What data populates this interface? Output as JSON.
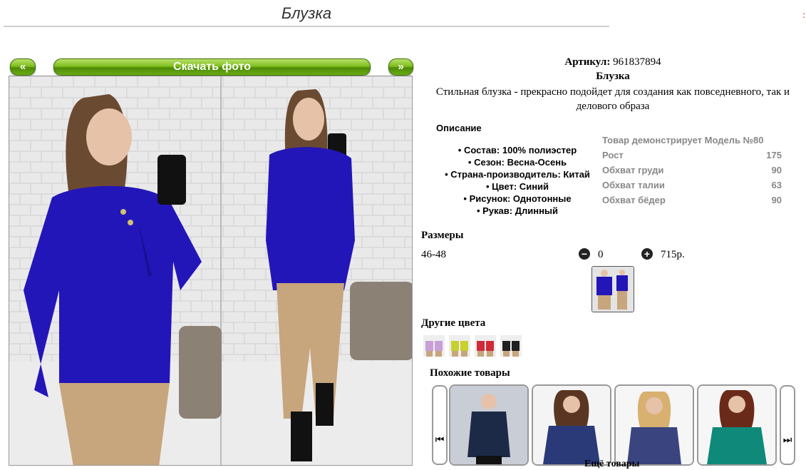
{
  "header": {
    "title": "Блузка",
    "corner_mark": ":"
  },
  "gallery": {
    "prev_label": "«",
    "download_label": "Скачать фото",
    "next_label": "»"
  },
  "product": {
    "article_label": "Артикул:",
    "article_value": "961837894",
    "name": "Блузка",
    "description": "Стильная блузка - прекрасно подойдет для создания как повседневного, так и делового образа",
    "description_heading": "Описание",
    "specs": [
      "Состав: 100% полиэстер",
      "Сезон: Весна-Осень",
      "Страна-производитель: Китай",
      "Цвет: Синий",
      "Рисунок: Однотонные",
      "Рукав: Длинный"
    ],
    "model": {
      "heading": "Товар демонстрирует Модель №80",
      "rows": [
        {
          "label": "Рост",
          "value": "175"
        },
        {
          "label": "Обхват груди",
          "value": "90"
        },
        {
          "label": "Обхват талии",
          "value": "63"
        },
        {
          "label": "Обхват бёдер",
          "value": "90"
        }
      ]
    },
    "sizes_heading": "Размеры",
    "size": "46-48",
    "quantity": "0",
    "price": "715р.",
    "minus_icon": "minus-circle-icon",
    "plus_icon": "plus-circle-icon"
  },
  "other_colors": {
    "heading": "Другие цвета",
    "swatches": [
      "#c8a0d8",
      "#c8d030",
      "#d02a3a",
      "#202020"
    ]
  },
  "similar": {
    "heading": "Похожие товары",
    "prev_icon": "skip-back-icon",
    "next_icon": "skip-forward-icon",
    "items_colors": [
      "#1c2a48",
      "#2a3a78",
      "#3a4580",
      "#0f8a7a"
    ],
    "more_label": "Ещё товары"
  },
  "colors": {
    "accent_green": "#6aad14",
    "blouse_blue": "#2316b8",
    "pants_beige": "#c7a57d"
  }
}
